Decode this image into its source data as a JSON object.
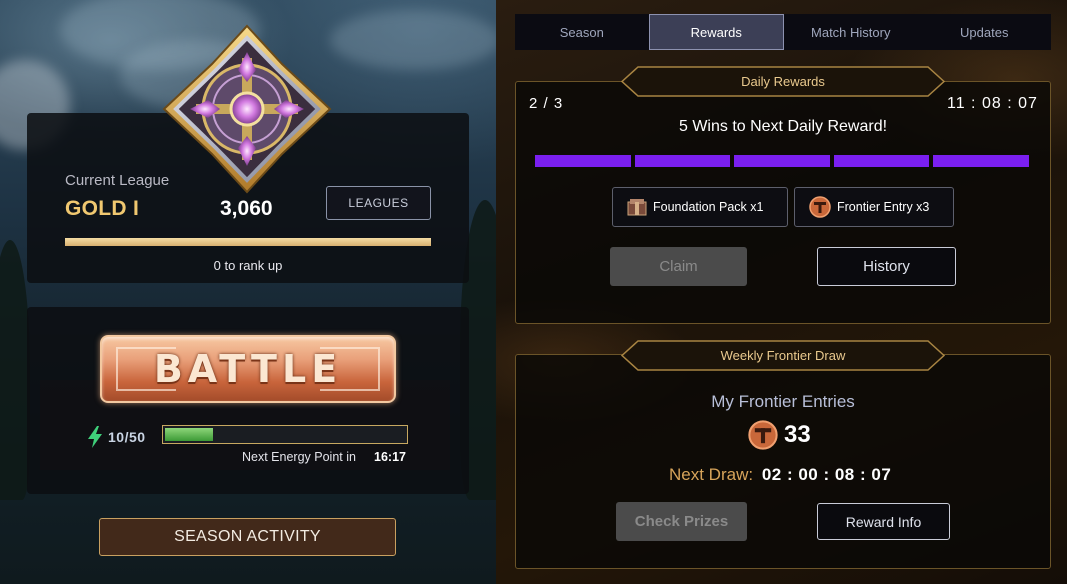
{
  "league": {
    "current_label": "Current League",
    "name": "GOLD I",
    "rating": "3,060",
    "leagues_button": "LEAGUES",
    "rank_progress": 1.0,
    "rank_up_text": "0 to rank up",
    "emblem_icon": "gold-league-emblem-icon"
  },
  "battle": {
    "button_label": "BATTLE",
    "energy_text": "10/50",
    "energy_fraction": 0.2,
    "next_energy_label": "Next Energy Point in",
    "next_energy_time": "16:17"
  },
  "season_activity_label": "SEASON ACTIVITY",
  "tabs": [
    {
      "label": "Season",
      "active": false
    },
    {
      "label": "Rewards",
      "active": true
    },
    {
      "label": "Match History",
      "active": false
    },
    {
      "label": "Updates",
      "active": false
    }
  ],
  "daily": {
    "title": "Daily Rewards",
    "progress_text": "2 / 3",
    "timer": "11 : 08 : 07",
    "wins_text": "5 Wins to Next Daily Reward!",
    "segments": 5,
    "segments_filled": 5,
    "bar_color": "#7a1ff0",
    "rewards": [
      {
        "label": "Foundation Pack x1",
        "icon": "foundation-pack-icon"
      },
      {
        "label": "Frontier Entry x3",
        "icon": "frontier-entry-icon"
      }
    ],
    "claim_label": "Claim",
    "history_label": "History"
  },
  "weekly": {
    "title": "Weekly Frontier Draw",
    "entries_label": "My Frontier Entries",
    "entries_count": "33",
    "next_draw_label": "Next Draw:",
    "next_draw_time": "02 : 00 : 08 : 07",
    "check_prizes_label": "Check Prizes",
    "reward_info_label": "Reward Info"
  }
}
